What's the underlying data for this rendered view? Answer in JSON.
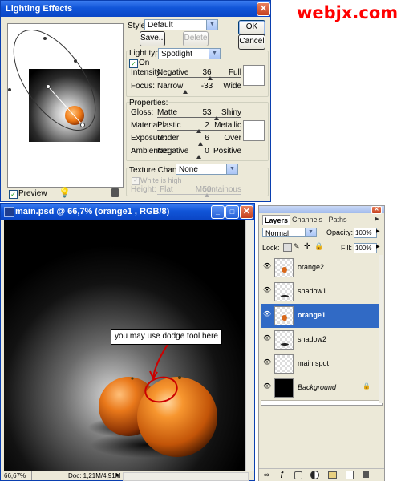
{
  "watermark": "webjx.com",
  "lighting": {
    "title": "Lighting Effects",
    "style_label": "Style:",
    "style_value": "Default",
    "save_label": "Save...",
    "delete_label": "Delete",
    "ok_label": "OK",
    "cancel_label": "Cancel",
    "light_type_label": "Light type:",
    "light_type_value": "Spotlight",
    "on_label": "On",
    "on_checked": true,
    "intensity": {
      "label": "Intensity:",
      "low": "Negative",
      "high": "Full",
      "value": "36"
    },
    "focus": {
      "label": "Focus:",
      "low": "Narrow",
      "high": "Wide",
      "value": "-33"
    },
    "properties_label": "Properties:",
    "gloss": {
      "label": "Gloss:",
      "low": "Matte",
      "high": "Shiny",
      "value": "53"
    },
    "material": {
      "label": "Material:",
      "low": "Plastic",
      "high": "Metallic",
      "value": "2"
    },
    "exposure": {
      "label": "Exposure:",
      "low": "Under",
      "high": "Over",
      "value": "6"
    },
    "ambience": {
      "label": "Ambience:",
      "low": "Negative",
      "high": "Positive",
      "value": "0"
    },
    "texture_label": "Texture Channel:",
    "texture_value": "None",
    "white_high_label": "White is high",
    "height": {
      "label": "Height:",
      "low": "Flat",
      "high": "Mountainous",
      "value": "50"
    },
    "preview_label": "Preview",
    "preview_checked": true
  },
  "document": {
    "title": "main.psd @ 66,7% (orange1 , RGB/8)",
    "annotation": "you may use dodge tool here",
    "zoom": "66,67%",
    "doc_info": "Doc: 1,21M/4,91M"
  },
  "layers": {
    "tabs": [
      "Layers",
      "Channels",
      "Paths"
    ],
    "active_tab": "Layers",
    "blend_mode": "Normal",
    "opacity_label": "Opacity:",
    "opacity_value": "100%",
    "lock_label": "Lock:",
    "fill_label": "Fill:",
    "fill_value": "100%",
    "items": [
      {
        "name": "orange2",
        "selected": false
      },
      {
        "name": "shadow1",
        "selected": false
      },
      {
        "name": "orange1",
        "selected": true
      },
      {
        "name": "shadow2",
        "selected": false
      },
      {
        "name": "main spot",
        "selected": false
      },
      {
        "name": "Background",
        "selected": false
      }
    ]
  },
  "colors": {
    "title_bar": "#0a46c6",
    "dialog_bg": "#ece9d8",
    "selected_layer": "#316ac5",
    "watermark": "#ff0000",
    "annotation_stroke": "#cc0000"
  }
}
